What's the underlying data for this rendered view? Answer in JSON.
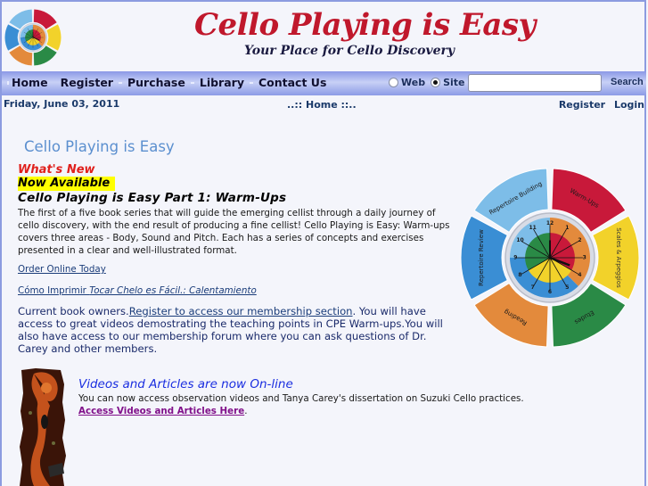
{
  "header": {
    "logo_icon": "practice-wheel-logo",
    "title": "Cello Playing is Easy",
    "subtitle": "Your Place for Cello Discovery"
  },
  "nav": {
    "items": [
      {
        "label": "Home"
      },
      {
        "label": "Register"
      },
      {
        "label": "Purchase"
      },
      {
        "label": "Library"
      },
      {
        "label": "Contact Us"
      }
    ],
    "search": {
      "scope_options": [
        {
          "label": "Web",
          "checked": false
        },
        {
          "label": "Site",
          "checked": true
        }
      ],
      "value": "",
      "placeholder": "",
      "button_label": "Search"
    }
  },
  "infobar": {
    "date": "Friday, June 03, 2011",
    "breadcrumb": "..:: Home ::..",
    "register_label": "Register",
    "login_label": "Login"
  },
  "main": {
    "page_title": "Cello Playing is Easy",
    "whats_new": "What's New",
    "now_available": "Now Available",
    "book_title": "Cello Playing is Easy Part 1: Warm-Ups",
    "book_description": "The first of a five book series that will guide the emerging cellist through a daily journey of cello discovery, with the end result of producing a fine cellist! Cello Playing is Easy: Warm-ups covers three areas - Body, Sound and Pitch. Each has a series of concepts and exercises presented in a clear and well-illustrated format.",
    "order_link": "Order Online Today",
    "spanish_link_prefix": "Cómo Imprimir ",
    "spanish_link_italic": "Tocar Chelo es Fácil.: Calentamiento",
    "member_prefix": "Current book owners.",
    "member_link": "Register to access our membership section",
    "member_suffix": ".  You will have access to great videos demostrating the teaching points in CPE Warm-ups.You will also have access to our membership forum where you can ask questions of Dr. Carey and other members.",
    "videos": {
      "image_icon": "cello-scroll-image",
      "title": "Videos and Articles are now On-line",
      "description": "You can now access observation videos and Tanya Carey's dissertation on Suzuki Cello practices.",
      "link": "Access Videos and Articles Here",
      "link_suffix": "."
    }
  },
  "wheel": {
    "segments": [
      {
        "label": "Warm-Ups",
        "color": "#c8193a"
      },
      {
        "label": "Scales & Arpeggios",
        "color": "#f2d22a"
      },
      {
        "label": "Etudes",
        "color": "#2a8a46"
      },
      {
        "label": "Reading",
        "color": "#e38a3c"
      },
      {
        "label": "Repertoire Review",
        "color": "#3a8ed4"
      },
      {
        "label": "Repertoire Building",
        "color": "#7dbde8"
      }
    ],
    "clock_numbers": [
      "12",
      "1",
      "2",
      "3",
      "4",
      "5",
      "6",
      "7",
      "8",
      "9",
      "10",
      "11"
    ]
  },
  "colors": {
    "title_red": "#c0182c",
    "nav_blue": "#8a98e6",
    "link_blue": "#1b3d7a",
    "visited_purple": "#80108a"
  }
}
